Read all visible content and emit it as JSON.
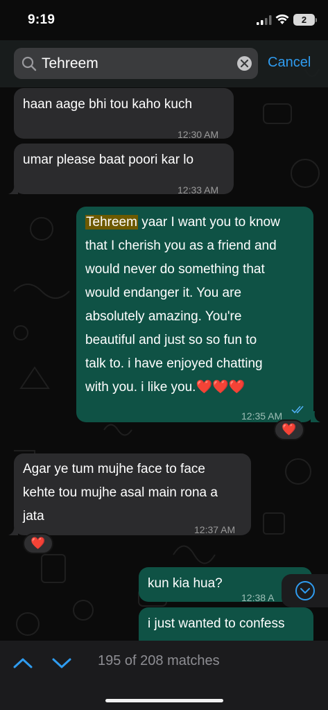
{
  "status_bar": {
    "time": "9:19",
    "battery": "2"
  },
  "search": {
    "query": "Tehreem",
    "cancel_label": "Cancel"
  },
  "messages": [
    {
      "direction": "in",
      "text": "haan aage bhi tou kaho kuch",
      "time": "12:30 AM"
    },
    {
      "direction": "in",
      "text": "umar please baat poori kar lo",
      "time": "12:33 AM"
    },
    {
      "direction": "out",
      "highlight": "Tehreem",
      "lines": [
        " yaar I want you to know",
        "that I cherish you as a friend and",
        "would never do something that",
        "would endanger it. You are",
        "absolutely amazing. You're",
        "beautiful and just so so fun to",
        "talk to. i have enjoyed chatting",
        "with you. i like you."
      ],
      "emojis": "❤️❤️❤️",
      "time": "12:35 AM",
      "reaction": "❤️"
    },
    {
      "direction": "in",
      "lines": [
        "Agar ye tum mujhe face to face",
        "kehte tou mujhe asal main rona a",
        "jata"
      ],
      "time": "12:37 AM",
      "reaction": "❤️"
    },
    {
      "direction": "out",
      "text": "kun kia hua?",
      "time": "12:38 A"
    },
    {
      "direction": "out",
      "text": "i just wanted to confess"
    }
  ],
  "bottom_bar": {
    "match_count": "195 of 208 matches"
  },
  "colors": {
    "incoming_bubble": "#2b2b2d",
    "outgoing_bubble": "#0f5245",
    "accent": "#2f9cf0",
    "highlight": "#6e5a00"
  }
}
